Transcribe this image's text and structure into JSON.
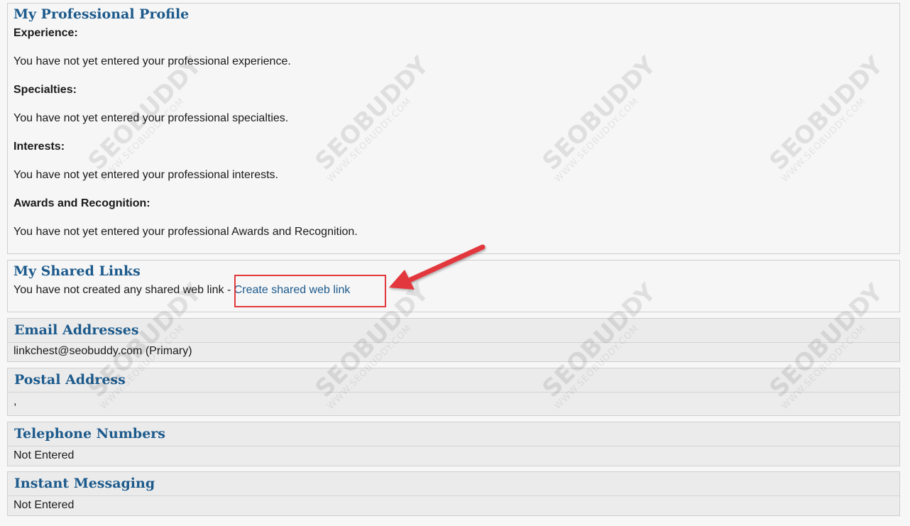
{
  "profile": {
    "title": "My Professional Profile",
    "experience_label": "Experience:",
    "experience_text": "You have not yet entered your professional experience.",
    "specialties_label": "Specialties:",
    "specialties_text": "You have not yet entered your professional specialties.",
    "interests_label": "Interests:",
    "interests_text": "You have not yet entered your professional interests.",
    "awards_label": "Awards and Recognition:",
    "awards_text": "You have not yet entered your professional Awards and Recognition."
  },
  "shared_links": {
    "title": "My Shared Links",
    "empty_text": "You have not created any shared web link",
    "separator": " - ",
    "create_link": "Create shared web link"
  },
  "email": {
    "title": "Email Addresses",
    "value": "linkchest@seobuddy.com (Primary)"
  },
  "postal": {
    "title": "Postal Address",
    "value": ","
  },
  "telephone": {
    "title": "Telephone Numbers",
    "value": "Not Entered"
  },
  "instant_messaging": {
    "title": "Instant Messaging",
    "value": "Not Entered"
  },
  "watermark": {
    "brand": "SEOBUDDY",
    "site": "WWW.SEOBUDDY.COM"
  },
  "colors": {
    "heading_blue": "#1c5a8c",
    "callout_red": "#e2383d"
  }
}
